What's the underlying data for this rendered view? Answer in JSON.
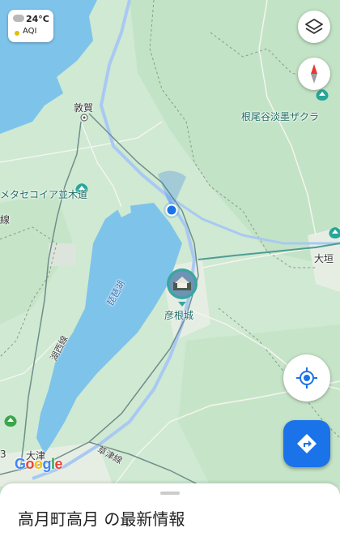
{
  "weather": {
    "temperature": "24°C",
    "aqi_label": "AQI",
    "icon": "cloud-icon"
  },
  "controls": {
    "layers": "layers-icon",
    "compass": "compass-icon",
    "location": "my-location-icon",
    "directions": "directions-icon"
  },
  "places": {
    "tsuruga": "敦賀",
    "metasequoia": "メタセコイア並木道",
    "neodani": "根尾谷淡墨ザクラ",
    "ogaki": "大垣",
    "lake_biwa": "琵琶湖",
    "hikone_castle": "彦根城",
    "otsu": "大津",
    "kosei_line": "湖西線",
    "kusatsu_line": "草津線",
    "edge_left": "線",
    "edge_bottom": "3"
  },
  "brand": {
    "logo": "Google",
    "colors": [
      "#4285F4",
      "#EA4335",
      "#FBBC05",
      "#4285F4",
      "#34A853",
      "#EA4335"
    ]
  },
  "sheet": {
    "title": "高月町高月 の最新情報"
  },
  "colors": {
    "land": "#cde9d0",
    "water": "#7ec3ea",
    "accent": "#1a73e8"
  }
}
